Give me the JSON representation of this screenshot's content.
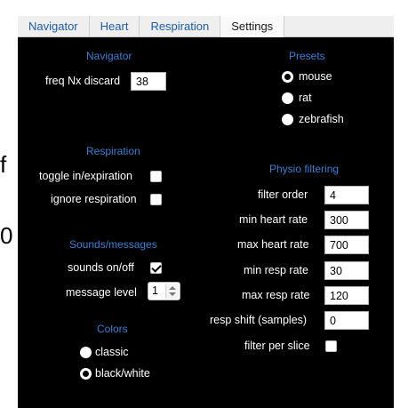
{
  "stray": {
    "f": "f",
    "zero": "0"
  },
  "tabs": [
    {
      "label": "Navigator"
    },
    {
      "label": "Heart"
    },
    {
      "label": "Respiration"
    },
    {
      "label": "Settings"
    }
  ],
  "active_tab": "Settings",
  "left": {
    "navigator_title": "Navigator",
    "freq_label": "freq Nx discard",
    "freq_value": "38",
    "respiration_title": "Respiration",
    "toggle_label": "toggle in/expiration",
    "toggle_checked": false,
    "ignore_label": "ignore respiration",
    "ignore_checked": false,
    "sounds_title": "Sounds/messages",
    "sounds_label": "sounds on/off",
    "sounds_checked": true,
    "message_label": "message level",
    "message_value": "1",
    "colors_title": "Colors",
    "classic_label": "classic",
    "bw_label": "black/white",
    "selected_color": "black/white"
  },
  "right": {
    "presets_title": "Presets",
    "mouse_label": "mouse",
    "rat_label": "rat",
    "zebrafish_label": "zebrafish",
    "selected_preset": "mouse",
    "physio_title": "Physio filtering",
    "filter_order_label": "filter order",
    "filter_order_value": "4",
    "min_heart_label": "min heart rate",
    "min_heart_value": "300",
    "max_heart_label": "max heart rate",
    "max_heart_value": "700",
    "min_resp_label": "min resp rate",
    "min_resp_value": "30",
    "max_resp_label": "max resp rate",
    "max_resp_value": "120",
    "resp_shift_label": "resp shift (samples)",
    "resp_shift_value": "0",
    "filter_slice_label": "filter per slice",
    "filter_slice_checked": false
  },
  "colors": {
    "panel_bg": "#000000",
    "section_title": "#3b7fd2",
    "tab_text": "#1d5ba8"
  }
}
